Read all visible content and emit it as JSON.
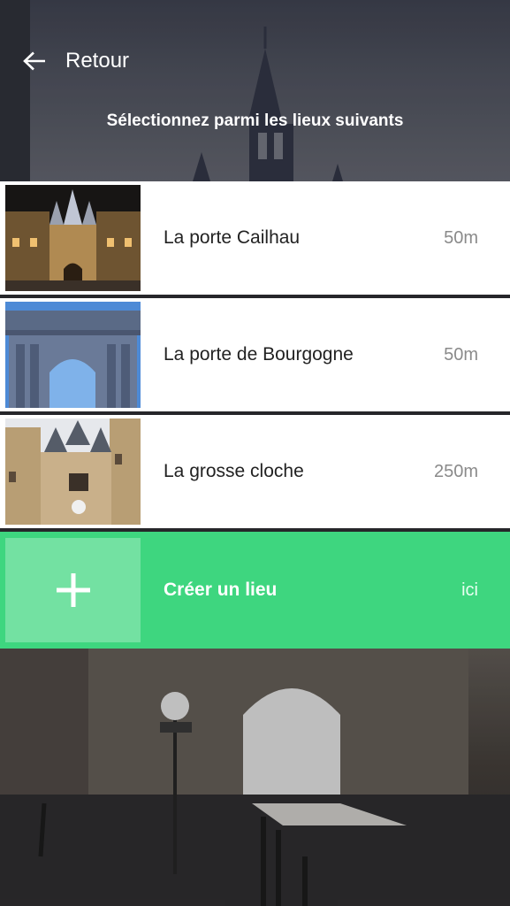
{
  "header": {
    "back_label": "Retour",
    "subtitle": "Sélectionnez parmi les lieux suivants"
  },
  "places": [
    {
      "name": "La porte Cailhau",
      "distance": "50m",
      "thumb_icon": "porte-cailhau-photo"
    },
    {
      "name": "La porte de Bourgogne",
      "distance": "50m",
      "thumb_icon": "porte-bourgogne-photo"
    },
    {
      "name": "La grosse cloche",
      "distance": "250m",
      "thumb_icon": "grosse-cloche-photo"
    }
  ],
  "create": {
    "label": "Créer un lieu",
    "location": "ici",
    "icon": "plus-icon"
  },
  "colors": {
    "accent_green": "#3ed67f",
    "row_background": "#ffffff",
    "distance_text": "#8a8a8a"
  }
}
